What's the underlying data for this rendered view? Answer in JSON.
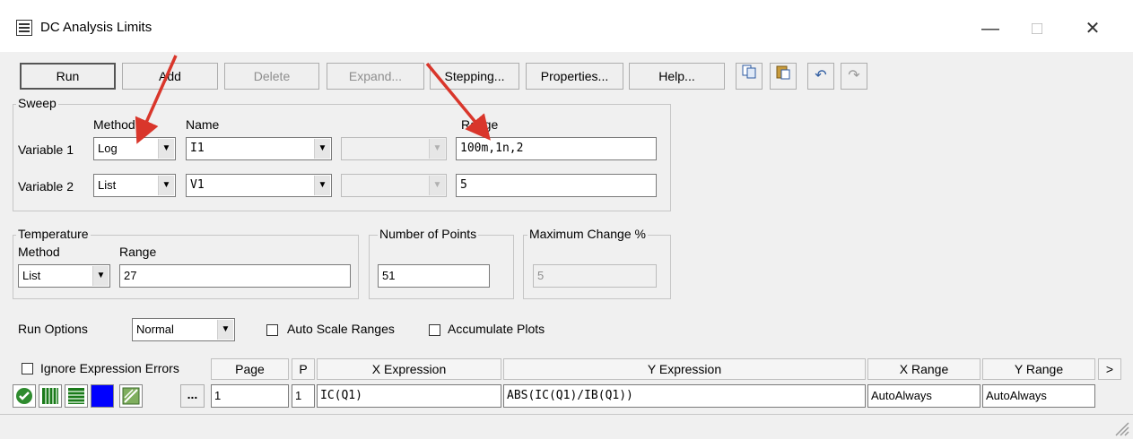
{
  "window": {
    "title": "DC Analysis Limits",
    "minimize": "—",
    "maximize": "□",
    "close": "✕"
  },
  "toolbar": {
    "run": "Run",
    "add": "Add",
    "delete": "Delete",
    "expand": "Expand...",
    "stepping": "Stepping...",
    "properties": "Properties...",
    "help": "Help...",
    "icons": [
      "copy-icon",
      "paste-icon",
      "undo-icon",
      "redo-icon"
    ]
  },
  "sweep": {
    "title": "Sweep",
    "col_method": "Method",
    "col_name": "Name",
    "col_range": "Range",
    "var1": {
      "label": "Variable 1",
      "method": "Log",
      "name": "I1",
      "range": "100m,1n,2"
    },
    "var2": {
      "label": "Variable 2",
      "method": "List",
      "name": "V1",
      "range": "5"
    }
  },
  "temperature": {
    "title": "Temperature",
    "method_label": "Method",
    "range_label": "Range",
    "method": "List",
    "range": "27"
  },
  "points": {
    "title": "Number of Points",
    "value": "51"
  },
  "max_change": {
    "title": "Maximum Change %",
    "value": "5"
  },
  "run_options": {
    "label": "Run Options",
    "value": "Normal",
    "auto_scale": "Auto Scale Ranges",
    "accumulate": "Accumulate Plots"
  },
  "plot_table": {
    "ignore_errors": "Ignore Expression Errors",
    "headers": {
      "page": "Page",
      "p": "P",
      "x_expr": "X Expression",
      "y_expr": "Y Expression",
      "x_range": "X Range",
      "y_range": "Y Range",
      "more": ">"
    },
    "row": {
      "page": "1",
      "p": "1",
      "x_expr": "IC(Q1)",
      "y_expr": "ABS(IC(Q1)/IB(Q1))",
      "x_range": "AutoAlways",
      "y_range": "AutoAlways",
      "more_btn": "..."
    }
  },
  "colors": {
    "annotation_arrow": "#d9362b",
    "plot_color": "#0000ff",
    "ok_icon": "#2e8b2e"
  }
}
